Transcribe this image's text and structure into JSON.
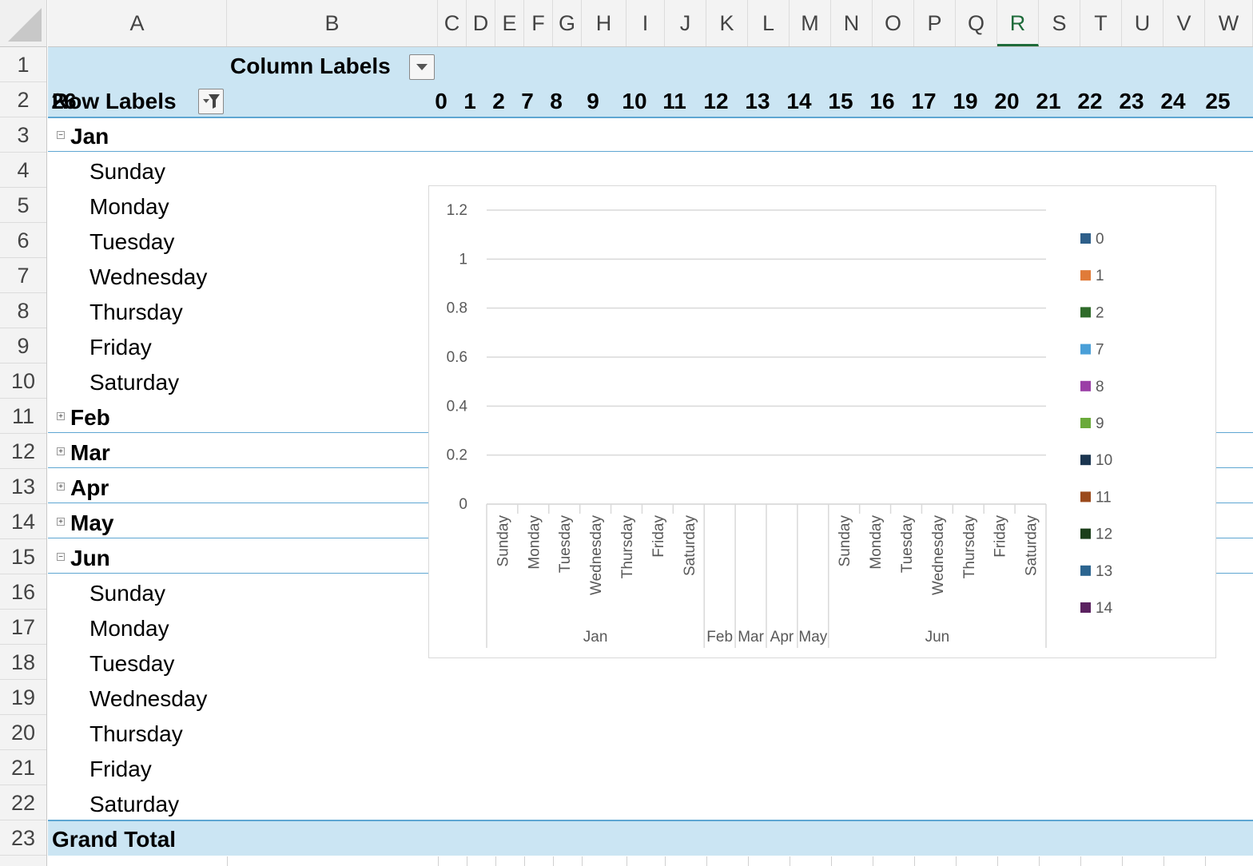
{
  "columns": [
    "A",
    "B",
    "C",
    "D",
    "E",
    "F",
    "G",
    "H",
    "I",
    "J",
    "K",
    "L",
    "M",
    "N",
    "O",
    "P",
    "Q",
    "R",
    "S",
    "T",
    "U",
    "V",
    "W"
  ],
  "selected_column": "R",
  "rows": [
    "1",
    "2",
    "3",
    "4",
    "5",
    "6",
    "7",
    "8",
    "9",
    "10",
    "11",
    "12",
    "13",
    "14",
    "15",
    "16",
    "17",
    "18",
    "19",
    "20",
    "21",
    "22",
    "23"
  ],
  "pivot": {
    "column_labels": "Column Labels",
    "row_labels": "Row Labels",
    "column_values": [
      "0",
      "1",
      "2",
      "7",
      "8",
      "9",
      "10",
      "11",
      "12",
      "13",
      "14",
      "15",
      "16",
      "17",
      "19",
      "20",
      "21",
      "22",
      "23",
      "24",
      "25",
      "26"
    ],
    "groups": [
      {
        "label": "Jan",
        "expanded": true,
        "days": [
          "Sunday",
          "Monday",
          "Tuesday",
          "Wednesday",
          "Thursday",
          "Friday",
          "Saturday"
        ]
      },
      {
        "label": "Feb",
        "expanded": false
      },
      {
        "label": "Mar",
        "expanded": false
      },
      {
        "label": "Apr",
        "expanded": false
      },
      {
        "label": "May",
        "expanded": false
      },
      {
        "label": "Jun",
        "expanded": true,
        "days": [
          "Sunday",
          "Monday",
          "Tuesday",
          "Wednesday",
          "Thursday",
          "Friday",
          "Saturday"
        ]
      }
    ],
    "grand_total": "Grand Total"
  },
  "chart_data": {
    "type": "bar",
    "yticks": [
      "1.2",
      "1",
      "0.8",
      "0.6",
      "0.4",
      "0.2",
      "0"
    ],
    "ylim": [
      0,
      1.2
    ],
    "gridlines": true,
    "legend_position": "right",
    "categories": [
      {
        "group": "Jan",
        "items": [
          "Sunday",
          "Monday",
          "Tuesday",
          "Wednesday",
          "Thursday",
          "Friday",
          "Saturday"
        ]
      },
      {
        "group": "Feb",
        "items": []
      },
      {
        "group": "Mar",
        "items": []
      },
      {
        "group": "Apr",
        "items": []
      },
      {
        "group": "May",
        "items": []
      },
      {
        "group": "Jun",
        "items": [
          "Sunday",
          "Monday",
          "Tuesday",
          "Wednesday",
          "Thursday",
          "Friday",
          "Saturday"
        ]
      }
    ],
    "series": [
      {
        "name": "0",
        "color": "#2e5f8a",
        "values": []
      },
      {
        "name": "1",
        "color": "#e07b39",
        "values": []
      },
      {
        "name": "2",
        "color": "#2f6b2a",
        "values": []
      },
      {
        "name": "7",
        "color": "#4a9fd8",
        "values": []
      },
      {
        "name": "8",
        "color": "#9b3fa6",
        "values": []
      },
      {
        "name": "9",
        "color": "#6aaa3a",
        "values": []
      },
      {
        "name": "10",
        "color": "#1b3550",
        "values": []
      },
      {
        "name": "11",
        "color": "#9b4a1c",
        "values": []
      },
      {
        "name": "12",
        "color": "#1b3f1a",
        "values": []
      },
      {
        "name": "13",
        "color": "#2c6590",
        "values": []
      },
      {
        "name": "14",
        "color": "#5b2260",
        "values": []
      }
    ]
  }
}
